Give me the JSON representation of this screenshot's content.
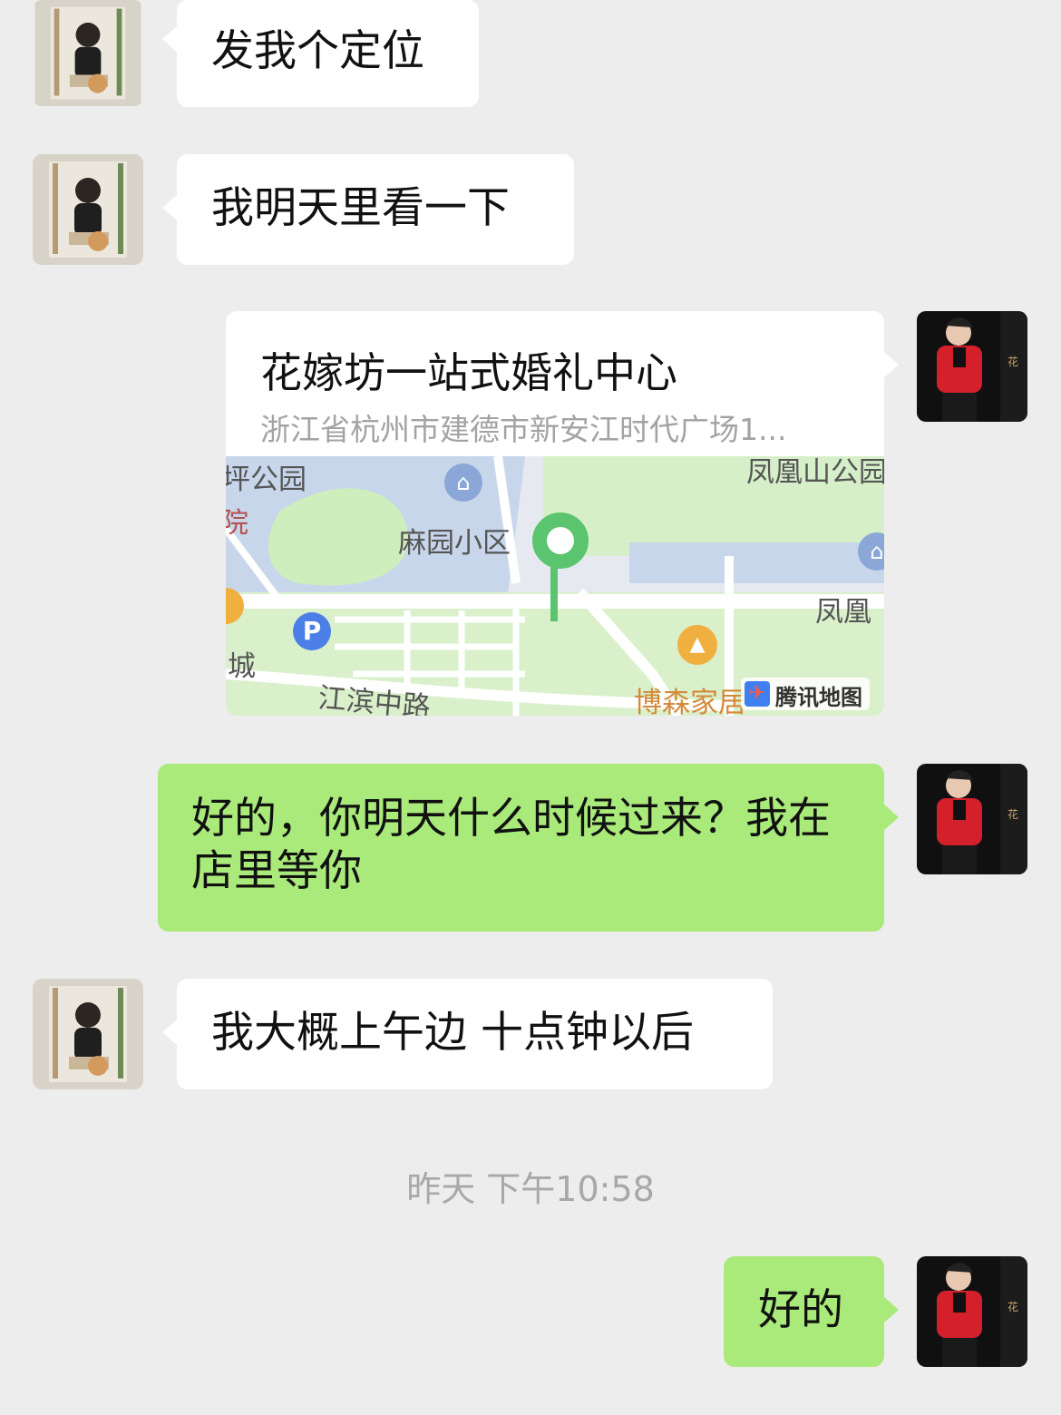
{
  "messages": [
    {
      "text": "发我个定位"
    },
    {
      "text": "我明天里看一下"
    },
    {
      "location": {
        "title": "花嫁坊一站式婚礼中心",
        "address": "浙江省杭州市建德市新安江时代广场1...",
        "map_labels": {
          "park_top_left": "坪公园",
          "hospital_left": "院",
          "phoenix_mountain": "凤凰山公园",
          "mayuan_community": "麻园小区",
          "phoenix_right": "凤凰",
          "city_left": "城",
          "jiangbin_road": "江滨中路",
          "bosen_home": "博森家居",
          "provider": "腾讯地图",
          "parking_letter": "P"
        }
      }
    },
    {
      "text": "好的，你明天什么时候过来？我在店里等你"
    },
    {
      "text": "我大概上午边 十点钟以后"
    },
    {
      "timestamp": "昨天 下午10:58"
    },
    {
      "text": "好的"
    }
  ],
  "colors": {
    "background": "#ededed",
    "incoming_bubble": "#ffffff",
    "outgoing_bubble": "#a9ea7a",
    "map_pin": "#5bc46e"
  },
  "icons": [
    "contact-avatar",
    "self-avatar",
    "map-pin-icon",
    "home-icon",
    "parking-icon",
    "shop-icon",
    "tencent-map-logo-icon"
  ]
}
